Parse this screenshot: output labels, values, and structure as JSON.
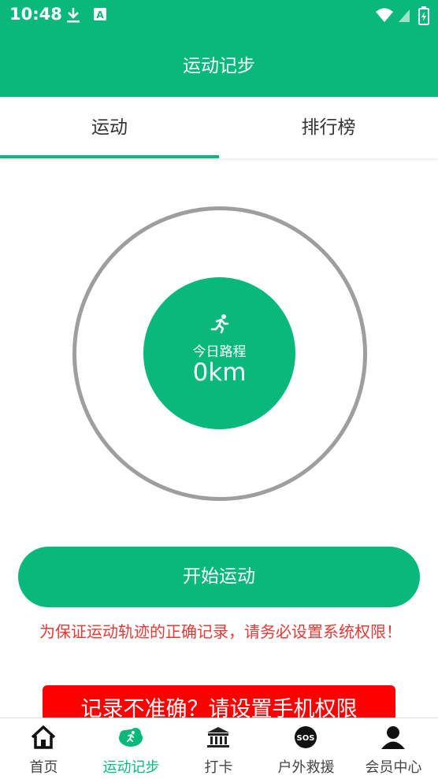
{
  "status_bar": {
    "time": "10:48"
  },
  "header": {
    "title": "运动记步"
  },
  "tabs": [
    {
      "label": "运动",
      "active": true
    },
    {
      "label": "排行榜",
      "active": false
    }
  ],
  "progress_circle": {
    "label": "今日路程",
    "value": "0km",
    "icon": "running-icon"
  },
  "start_button": {
    "label": "开始运动"
  },
  "notice": {
    "text": "为保证运动轨迹的正确记录，请务必设置系统权限！"
  },
  "permission_button": {
    "label": "记录不准确？请设置手机权限"
  },
  "bottom_nav": [
    {
      "label": "首页",
      "icon": "home-icon"
    },
    {
      "label": "运动记步",
      "icon": "step-icon",
      "active": true
    },
    {
      "label": "打卡",
      "icon": "checkin-icon"
    },
    {
      "label": "户外救援",
      "icon": "sos-icon"
    },
    {
      "label": "会员中心",
      "icon": "user-icon"
    }
  ],
  "colors": {
    "accent": "#09b97b",
    "warning": "#e53935",
    "alert_bg": "#ff0000",
    "ring": "#9e9e9e"
  }
}
